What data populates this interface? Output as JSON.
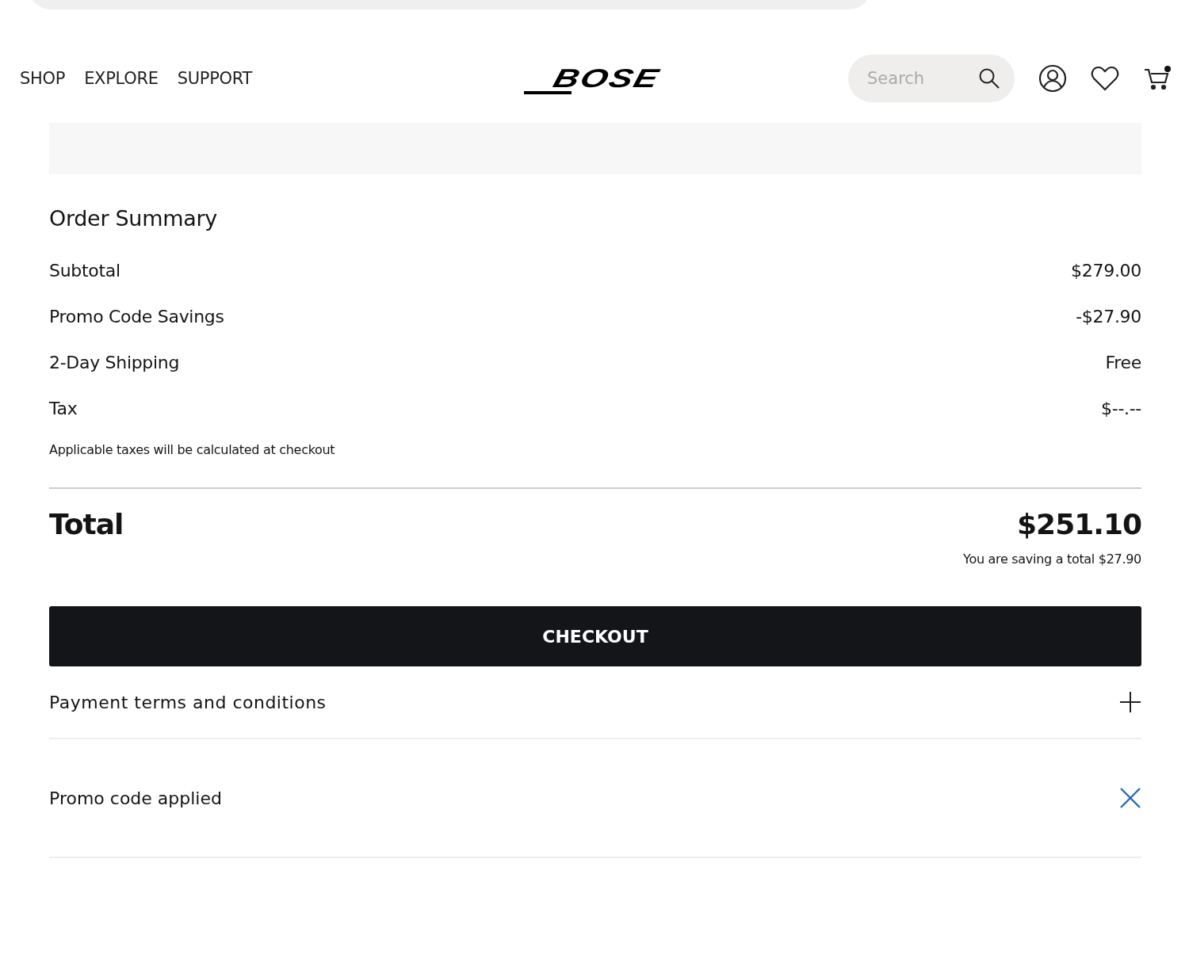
{
  "nav": {
    "links": [
      "SHOP",
      "EXPLORE",
      "SUPPORT"
    ],
    "logo": "BOSE",
    "search": {
      "placeholder": "Search"
    },
    "cart_has_items": true
  },
  "order_summary": {
    "title": "Order Summary",
    "lines": [
      {
        "label": "Subtotal",
        "value": "$279.00"
      },
      {
        "label": "Promo Code Savings",
        "value": "-$27.90"
      },
      {
        "label": "2-Day Shipping",
        "value": "Free"
      },
      {
        "label": "Tax",
        "value": "$--.--"
      }
    ],
    "tax_note": "Applicable taxes will be calculated at checkout",
    "total_label": "Total",
    "total_value": "$251.10",
    "savings_note": "You are saving a total $27.90",
    "checkout_button": "CHECKOUT",
    "payment_terms": {
      "label": "Payment terms and conditions",
      "expanded": false
    },
    "promo": {
      "label": "Promo code applied"
    }
  }
}
